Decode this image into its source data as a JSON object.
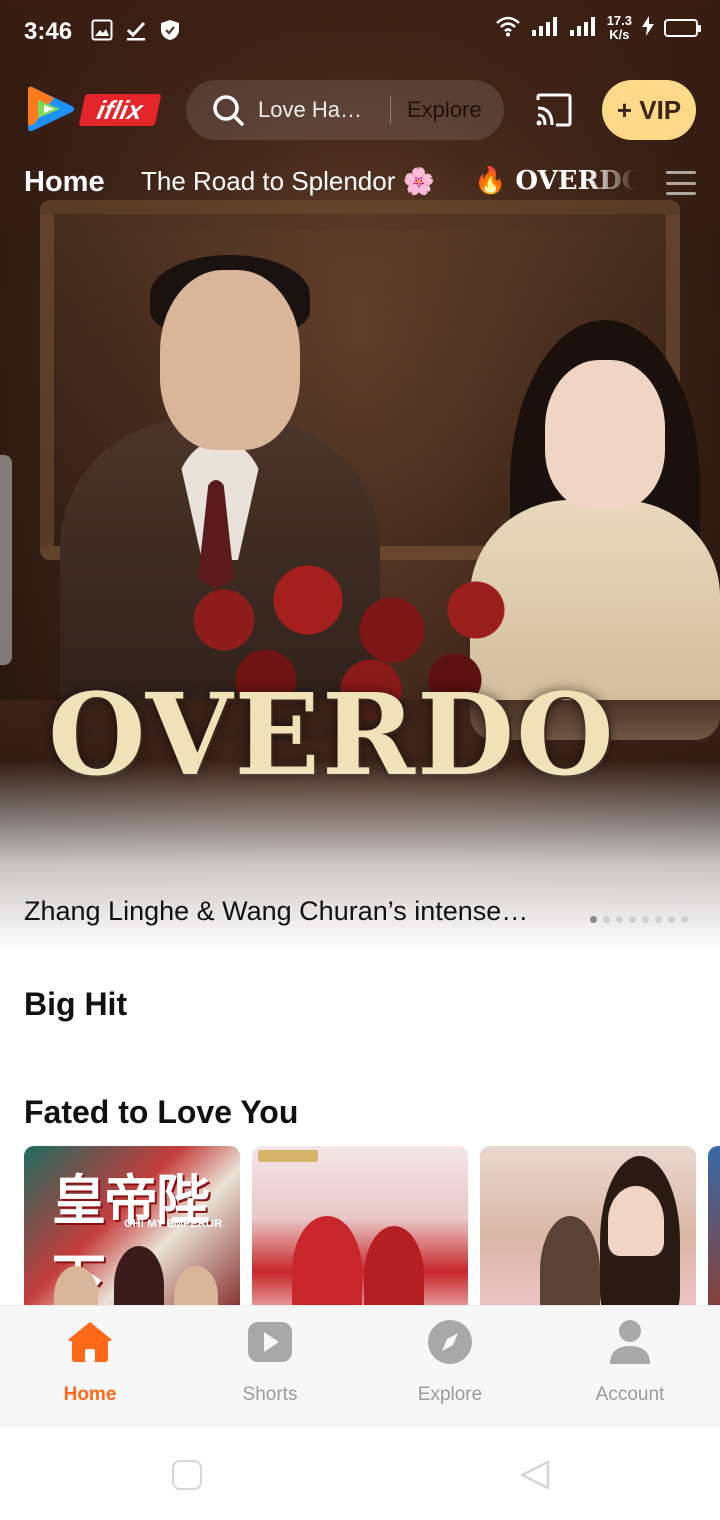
{
  "status_bar": {
    "time": "3:46",
    "net_speed_value": "17.3",
    "net_speed_unit": "K/s"
  },
  "header": {
    "brand": "iflix",
    "search_placeholder": "Love Ha…",
    "explore_label": "Explore",
    "vip_label": "+ VIP"
  },
  "tabs": [
    {
      "label": "Home"
    },
    {
      "label": "The Road to Splendor 🌸"
    },
    {
      "label": "🔥 OVERDO"
    }
  ],
  "hero": {
    "logo_text": "OVERDO",
    "caption": "Zhang Linghe & Wang Churan’s intense…",
    "page_count": 8,
    "active_page": 1
  },
  "sections": {
    "big_hit": "Big Hit",
    "fated": "Fated to Love You"
  },
  "posters": [
    {
      "title": "皇帝陛下",
      "subtitle": "OH! MY EMPEROR"
    },
    {
      "title": ""
    },
    {
      "title": ""
    },
    {
      "title": ""
    }
  ],
  "bottom_nav": [
    {
      "label": "Home",
      "icon": "home-icon",
      "active": true
    },
    {
      "label": "Shorts",
      "icon": "play-icon",
      "active": false
    },
    {
      "label": "Explore",
      "icon": "compass-icon",
      "active": false
    },
    {
      "label": "Account",
      "icon": "user-icon",
      "active": false
    }
  ],
  "colors": {
    "accent": "#ff6a1a",
    "vip_bg": "#ffd98a",
    "brand_red": "#e4262b"
  }
}
